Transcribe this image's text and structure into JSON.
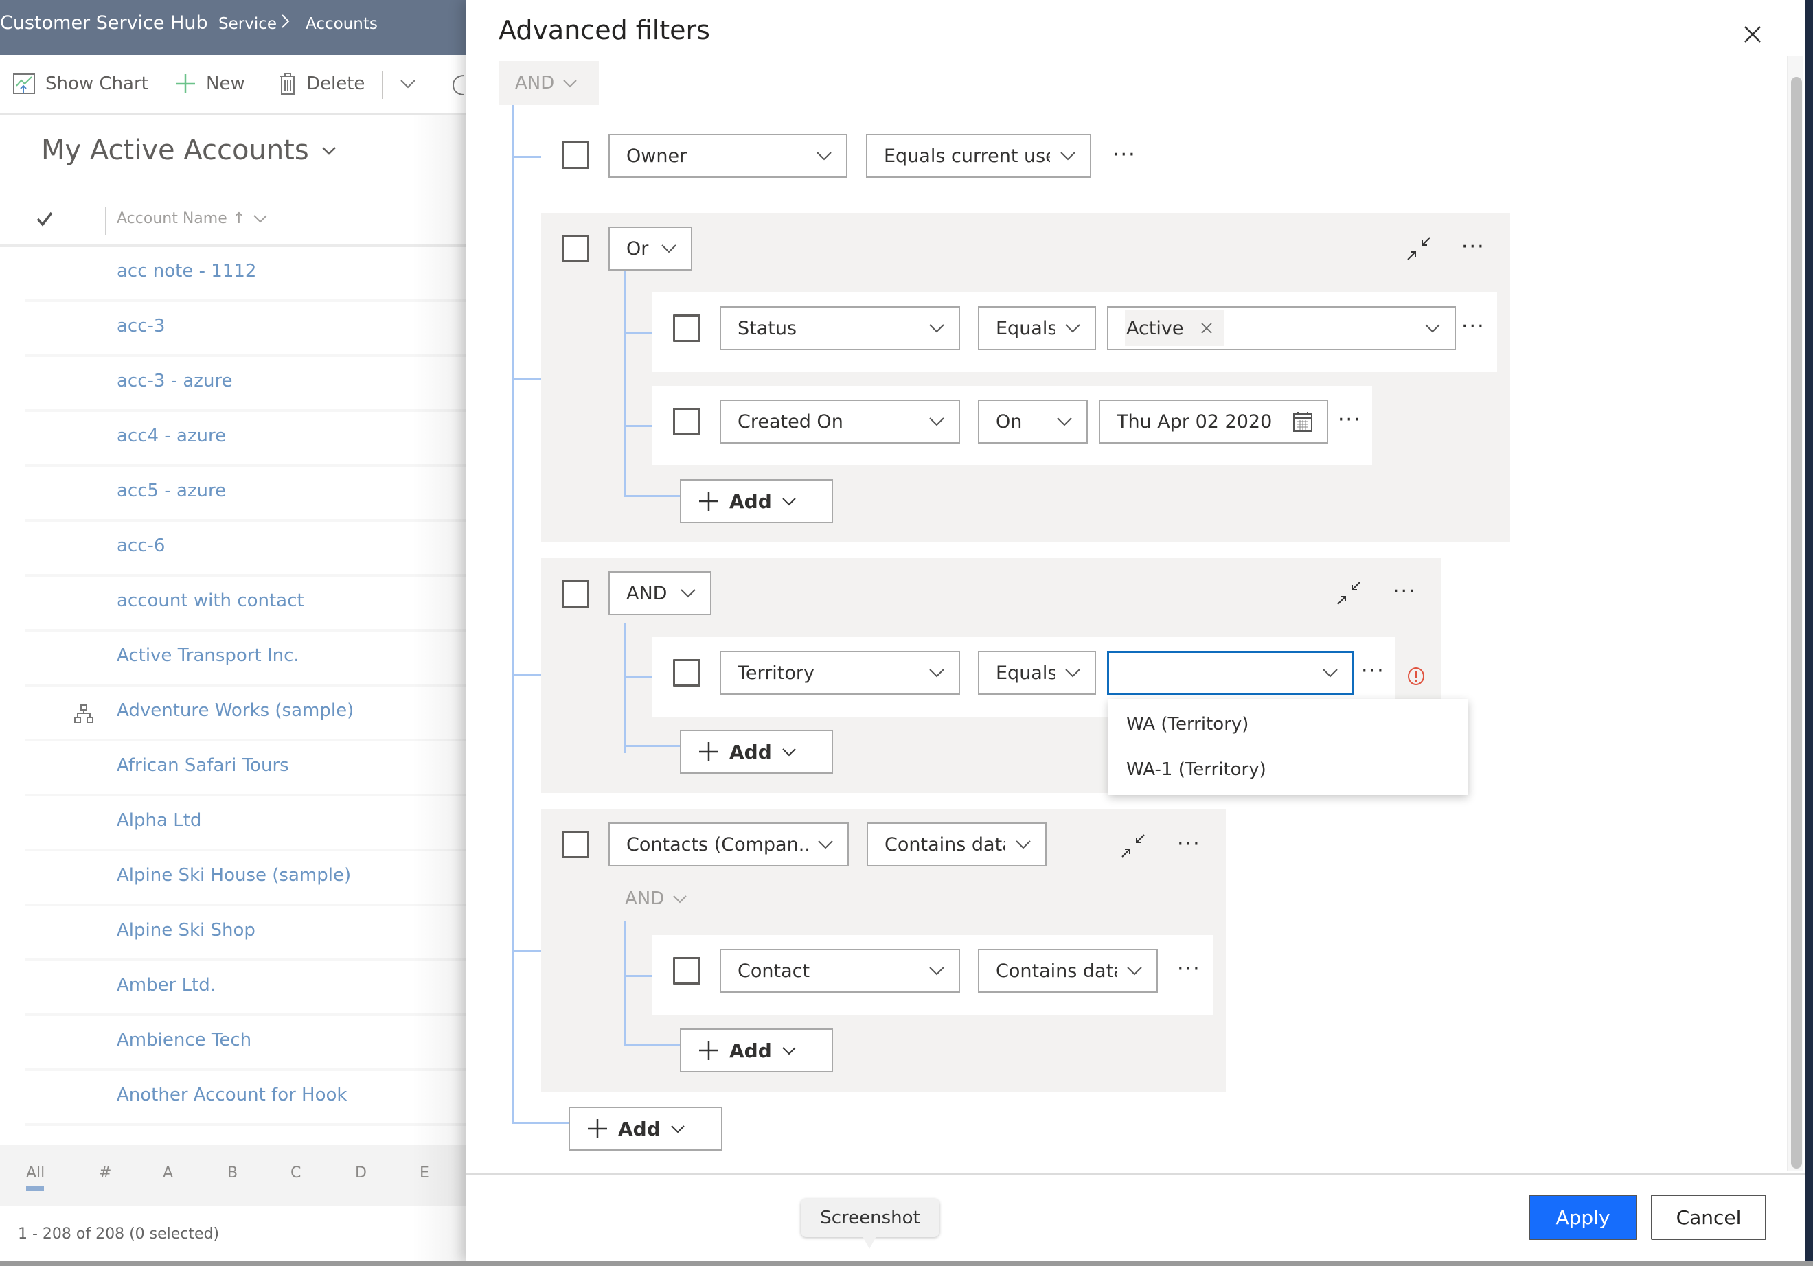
{
  "app": {
    "title": "Customer Service Hub",
    "breadcrumb": [
      "Service",
      "Accounts"
    ]
  },
  "commandbar": {
    "show_chart": "Show Chart",
    "new": "New",
    "delete": "Delete"
  },
  "view": {
    "title": "My Active Accounts",
    "column_header": "Account Name",
    "sort_indicator": "↑",
    "rows": [
      {
        "name": "acc note - 1112",
        "hierarchy": false
      },
      {
        "name": "acc-3",
        "hierarchy": false
      },
      {
        "name": "acc-3 - azure",
        "hierarchy": false
      },
      {
        "name": "acc4 - azure",
        "hierarchy": false
      },
      {
        "name": "acc5 - azure",
        "hierarchy": false
      },
      {
        "name": "acc-6",
        "hierarchy": false
      },
      {
        "name": "account with contact",
        "hierarchy": false
      },
      {
        "name": "Active Transport Inc.",
        "hierarchy": false
      },
      {
        "name": "Adventure Works (sample)",
        "hierarchy": true
      },
      {
        "name": "African Safari Tours",
        "hierarchy": false
      },
      {
        "name": "Alpha Ltd",
        "hierarchy": false
      },
      {
        "name": "Alpine Ski House (sample)",
        "hierarchy": false
      },
      {
        "name": "Alpine Ski Shop",
        "hierarchy": false
      },
      {
        "name": "Amber Ltd.",
        "hierarchy": false
      },
      {
        "name": "Ambience Tech",
        "hierarchy": false
      },
      {
        "name": "Another Account for Hook",
        "hierarchy": false
      }
    ],
    "jump_bar": [
      "All",
      "#",
      "A",
      "B",
      "C",
      "D",
      "E"
    ],
    "jump_bar_selected": "All",
    "status": "1 - 208 of 208 (0 selected)"
  },
  "dialog": {
    "title": "Advanced filters",
    "root_logic": "AND",
    "row_owner": {
      "field": "Owner",
      "operator": "Equals current user"
    },
    "group_or": {
      "logic": "Or",
      "conditions": [
        {
          "field": "Status",
          "operator": "Equals",
          "value_tag": "Active"
        },
        {
          "field": "Created On",
          "operator": "On",
          "value": "Thu Apr 02 2020"
        }
      ],
      "add_label": "Add"
    },
    "group_and": {
      "logic": "AND",
      "conditions": [
        {
          "field": "Territory",
          "operator": "Equals",
          "value": ""
        }
      ],
      "add_label": "Add",
      "dropdown_options": [
        "WA (Territory)",
        "WA-1 (Territory)"
      ]
    },
    "group_related": {
      "field": "Contacts (Compan...",
      "operator": "Contains data",
      "inner_logic": "AND",
      "conditions": [
        {
          "field": "Contact",
          "operator": "Contains data"
        }
      ],
      "add_label": "Add"
    },
    "root_add_label": "Add",
    "ellipsis": "···",
    "apply": "Apply",
    "cancel": "Cancel",
    "tooltip": "Screenshot"
  },
  "colors": {
    "header_bg": "#65748a",
    "link": "#6b95c3",
    "primary": "#166dfc",
    "tree_line": "#a9c7f2",
    "focus_border": "#0f6cbd",
    "error": "#e0533f",
    "group_bg": "#f3f2f1"
  }
}
